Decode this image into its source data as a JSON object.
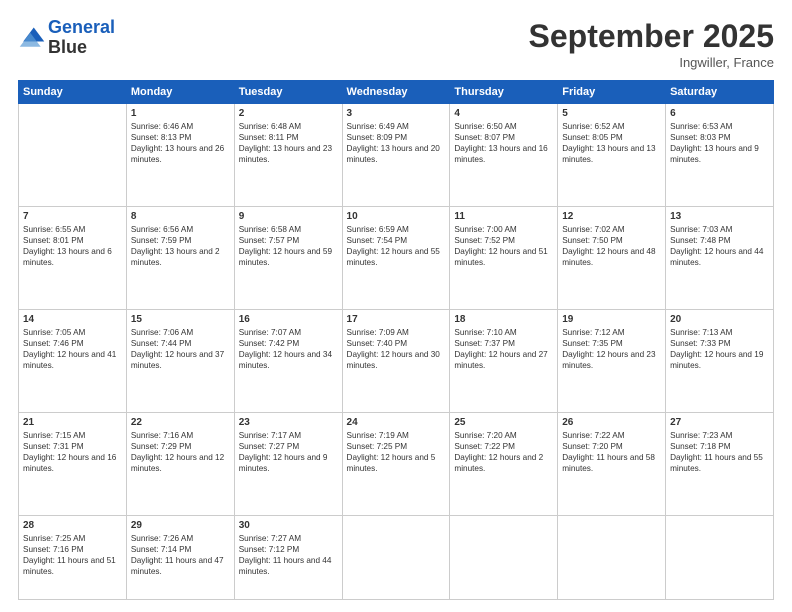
{
  "header": {
    "logo_line1": "General",
    "logo_line2": "Blue",
    "month": "September 2025",
    "location": "Ingwiller, France"
  },
  "days_of_week": [
    "Sunday",
    "Monday",
    "Tuesday",
    "Wednesday",
    "Thursday",
    "Friday",
    "Saturday"
  ],
  "weeks": [
    [
      {
        "day": "",
        "sunrise": "",
        "sunset": "",
        "daylight": ""
      },
      {
        "day": "1",
        "sunrise": "Sunrise: 6:46 AM",
        "sunset": "Sunset: 8:13 PM",
        "daylight": "Daylight: 13 hours and 26 minutes."
      },
      {
        "day": "2",
        "sunrise": "Sunrise: 6:48 AM",
        "sunset": "Sunset: 8:11 PM",
        "daylight": "Daylight: 13 hours and 23 minutes."
      },
      {
        "day": "3",
        "sunrise": "Sunrise: 6:49 AM",
        "sunset": "Sunset: 8:09 PM",
        "daylight": "Daylight: 13 hours and 20 minutes."
      },
      {
        "day": "4",
        "sunrise": "Sunrise: 6:50 AM",
        "sunset": "Sunset: 8:07 PM",
        "daylight": "Daylight: 13 hours and 16 minutes."
      },
      {
        "day": "5",
        "sunrise": "Sunrise: 6:52 AM",
        "sunset": "Sunset: 8:05 PM",
        "daylight": "Daylight: 13 hours and 13 minutes."
      },
      {
        "day": "6",
        "sunrise": "Sunrise: 6:53 AM",
        "sunset": "Sunset: 8:03 PM",
        "daylight": "Daylight: 13 hours and 9 minutes."
      }
    ],
    [
      {
        "day": "7",
        "sunrise": "Sunrise: 6:55 AM",
        "sunset": "Sunset: 8:01 PM",
        "daylight": "Daylight: 13 hours and 6 minutes."
      },
      {
        "day": "8",
        "sunrise": "Sunrise: 6:56 AM",
        "sunset": "Sunset: 7:59 PM",
        "daylight": "Daylight: 13 hours and 2 minutes."
      },
      {
        "day": "9",
        "sunrise": "Sunrise: 6:58 AM",
        "sunset": "Sunset: 7:57 PM",
        "daylight": "Daylight: 12 hours and 59 minutes."
      },
      {
        "day": "10",
        "sunrise": "Sunrise: 6:59 AM",
        "sunset": "Sunset: 7:54 PM",
        "daylight": "Daylight: 12 hours and 55 minutes."
      },
      {
        "day": "11",
        "sunrise": "Sunrise: 7:00 AM",
        "sunset": "Sunset: 7:52 PM",
        "daylight": "Daylight: 12 hours and 51 minutes."
      },
      {
        "day": "12",
        "sunrise": "Sunrise: 7:02 AM",
        "sunset": "Sunset: 7:50 PM",
        "daylight": "Daylight: 12 hours and 48 minutes."
      },
      {
        "day": "13",
        "sunrise": "Sunrise: 7:03 AM",
        "sunset": "Sunset: 7:48 PM",
        "daylight": "Daylight: 12 hours and 44 minutes."
      }
    ],
    [
      {
        "day": "14",
        "sunrise": "Sunrise: 7:05 AM",
        "sunset": "Sunset: 7:46 PM",
        "daylight": "Daylight: 12 hours and 41 minutes."
      },
      {
        "day": "15",
        "sunrise": "Sunrise: 7:06 AM",
        "sunset": "Sunset: 7:44 PM",
        "daylight": "Daylight: 12 hours and 37 minutes."
      },
      {
        "day": "16",
        "sunrise": "Sunrise: 7:07 AM",
        "sunset": "Sunset: 7:42 PM",
        "daylight": "Daylight: 12 hours and 34 minutes."
      },
      {
        "day": "17",
        "sunrise": "Sunrise: 7:09 AM",
        "sunset": "Sunset: 7:40 PM",
        "daylight": "Daylight: 12 hours and 30 minutes."
      },
      {
        "day": "18",
        "sunrise": "Sunrise: 7:10 AM",
        "sunset": "Sunset: 7:37 PM",
        "daylight": "Daylight: 12 hours and 27 minutes."
      },
      {
        "day": "19",
        "sunrise": "Sunrise: 7:12 AM",
        "sunset": "Sunset: 7:35 PM",
        "daylight": "Daylight: 12 hours and 23 minutes."
      },
      {
        "day": "20",
        "sunrise": "Sunrise: 7:13 AM",
        "sunset": "Sunset: 7:33 PM",
        "daylight": "Daylight: 12 hours and 19 minutes."
      }
    ],
    [
      {
        "day": "21",
        "sunrise": "Sunrise: 7:15 AM",
        "sunset": "Sunset: 7:31 PM",
        "daylight": "Daylight: 12 hours and 16 minutes."
      },
      {
        "day": "22",
        "sunrise": "Sunrise: 7:16 AM",
        "sunset": "Sunset: 7:29 PM",
        "daylight": "Daylight: 12 hours and 12 minutes."
      },
      {
        "day": "23",
        "sunrise": "Sunrise: 7:17 AM",
        "sunset": "Sunset: 7:27 PM",
        "daylight": "Daylight: 12 hours and 9 minutes."
      },
      {
        "day": "24",
        "sunrise": "Sunrise: 7:19 AM",
        "sunset": "Sunset: 7:25 PM",
        "daylight": "Daylight: 12 hours and 5 minutes."
      },
      {
        "day": "25",
        "sunrise": "Sunrise: 7:20 AM",
        "sunset": "Sunset: 7:22 PM",
        "daylight": "Daylight: 12 hours and 2 minutes."
      },
      {
        "day": "26",
        "sunrise": "Sunrise: 7:22 AM",
        "sunset": "Sunset: 7:20 PM",
        "daylight": "Daylight: 11 hours and 58 minutes."
      },
      {
        "day": "27",
        "sunrise": "Sunrise: 7:23 AM",
        "sunset": "Sunset: 7:18 PM",
        "daylight": "Daylight: 11 hours and 55 minutes."
      }
    ],
    [
      {
        "day": "28",
        "sunrise": "Sunrise: 7:25 AM",
        "sunset": "Sunset: 7:16 PM",
        "daylight": "Daylight: 11 hours and 51 minutes."
      },
      {
        "day": "29",
        "sunrise": "Sunrise: 7:26 AM",
        "sunset": "Sunset: 7:14 PM",
        "daylight": "Daylight: 11 hours and 47 minutes."
      },
      {
        "day": "30",
        "sunrise": "Sunrise: 7:27 AM",
        "sunset": "Sunset: 7:12 PM",
        "daylight": "Daylight: 11 hours and 44 minutes."
      },
      {
        "day": "",
        "sunrise": "",
        "sunset": "",
        "daylight": ""
      },
      {
        "day": "",
        "sunrise": "",
        "sunset": "",
        "daylight": ""
      },
      {
        "day": "",
        "sunrise": "",
        "sunset": "",
        "daylight": ""
      },
      {
        "day": "",
        "sunrise": "",
        "sunset": "",
        "daylight": ""
      }
    ]
  ]
}
